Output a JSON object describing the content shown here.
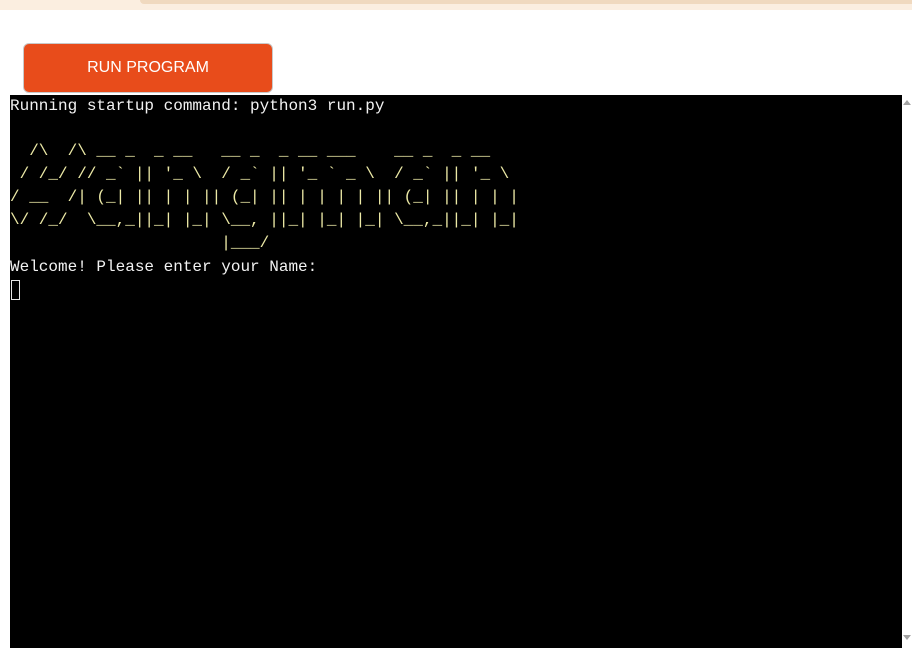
{
  "toolbar": {
    "run_button_label": "RUN PROGRAM",
    "run_button_color": "#e84c1b"
  },
  "terminal": {
    "startup_line": "Running startup command: python3 run.py",
    "ascii_art": [
      "  /\\  /\\ __ _  _ __   __ _  _ __ ___    __ _  _ __",
      " / /_/ // _` || '_ \\  / _` || '_ ` _ \\  / _` || '_ \\",
      "/ __  /| (_| || | | || (_| || | | | | || (_| || | | |",
      "\\/ /_/  \\__,_||_| |_| \\__, ||_| |_| |_| \\__,_||_| |_|",
      "                      |___/"
    ],
    "prompt_line": "Welcome! Please enter your Name:",
    "background_color": "#000000",
    "text_color": "#f2f2f2",
    "art_color": "#ece9a6"
  },
  "icons": {
    "cursor": "block-cursor-icon",
    "scroll_up": "chevron-up-icon",
    "scroll_down": "chevron-down-icon"
  }
}
